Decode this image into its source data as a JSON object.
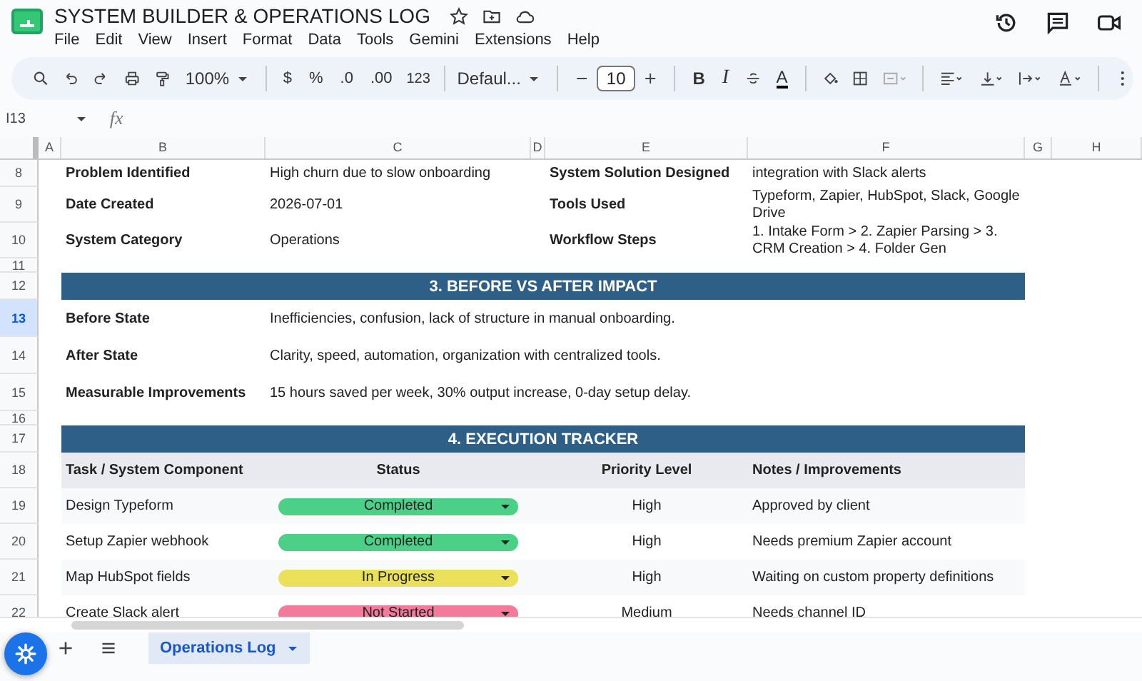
{
  "title": "SYSTEM BUILDER & OPERATIONS LOG",
  "menu": [
    "File",
    "Edit",
    "View",
    "Insert",
    "Format",
    "Data",
    "Tools",
    "Gemini",
    "Extensions",
    "Help"
  ],
  "toolbar": {
    "zoom": "100%",
    "currency": "$",
    "percent": "%",
    "decrease_decimals": ".0",
    "increase_decimals": ".00",
    "number_format": "123",
    "font": "Defaul...",
    "font_size": "10",
    "bold": "B",
    "italic": "I",
    "text_color": "A"
  },
  "name_box": "I13",
  "formula_label": "fx",
  "columns": [
    "A",
    "B",
    "C",
    "D",
    "E",
    "F",
    "G",
    "H"
  ],
  "rows": [
    {
      "number": "8",
      "selected": false,
      "kind": "field",
      "label": "Problem Identified",
      "value": "High churn due to slow onboarding",
      "label_2": "System Solution Designed",
      "value_2": "integration with Slack alerts"
    },
    {
      "number": "9",
      "selected": false,
      "kind": "field",
      "label": "Date Created",
      "value": "2026-07-01",
      "label_2": "Tools Used",
      "value_2": "Typeform, Zapier, HubSpot, Slack, Google Drive"
    },
    {
      "number": "10",
      "selected": false,
      "kind": "field",
      "label": "System Category",
      "value": "Operations",
      "label_2": "Workflow Steps",
      "value_2": "1. Intake Form > 2. Zapier Parsing > 3. CRM Creation > 4. Folder Gen"
    },
    {
      "number": "11",
      "selected": false,
      "kind": "blank"
    },
    {
      "number": "12",
      "selected": false,
      "kind": "section",
      "title": "3. BEFORE VS AFTER IMPACT"
    },
    {
      "number": "13",
      "selected": true,
      "kind": "detail",
      "label": "Before State",
      "value": "Inefficiencies, confusion, lack of structure in manual onboarding."
    },
    {
      "number": "14",
      "selected": false,
      "kind": "detail",
      "label": "After State",
      "value": "Clarity, speed, automation, organization with centralized tools."
    },
    {
      "number": "15",
      "selected": false,
      "kind": "detail",
      "label": "Measurable Improvements",
      "value": "15 hours saved per week, 30% output increase, 0-day setup delay."
    },
    {
      "number": "16",
      "selected": false,
      "kind": "blank"
    },
    {
      "number": "17",
      "selected": false,
      "kind": "section",
      "title": "4. EXECUTION TRACKER"
    },
    {
      "number": "18",
      "selected": false,
      "kind": "header",
      "task": "Task / System Component",
      "status": "Status",
      "priority": "Priority Level",
      "notes": "Notes / Improvements"
    },
    {
      "number": "19",
      "selected": false,
      "kind": "task",
      "task": "Design Typeform",
      "status": "Completed",
      "color": "#4ccf86",
      "priority": "High",
      "notes": "Approved by client"
    },
    {
      "number": "20",
      "selected": false,
      "kind": "task",
      "task": "Setup Zapier webhook",
      "status": "Completed",
      "color": "#4ccf86",
      "priority": "High",
      "notes": "Needs premium Zapier account"
    },
    {
      "number": "21",
      "selected": false,
      "kind": "task",
      "task": "Map HubSpot fields",
      "status": "In Progress",
      "color": "#ebe05a",
      "priority": "High",
      "notes": "Waiting on custom property definitions"
    },
    {
      "number": "22",
      "selected": false,
      "kind": "task",
      "task": "Create Slack alert",
      "status": "Not Started",
      "color": "#f47a9c",
      "priority": "Medium",
      "notes": "Needs channel ID"
    }
  ],
  "sheet_tabs": [
    {
      "label": "Operations Log",
      "selected": true
    }
  ]
}
